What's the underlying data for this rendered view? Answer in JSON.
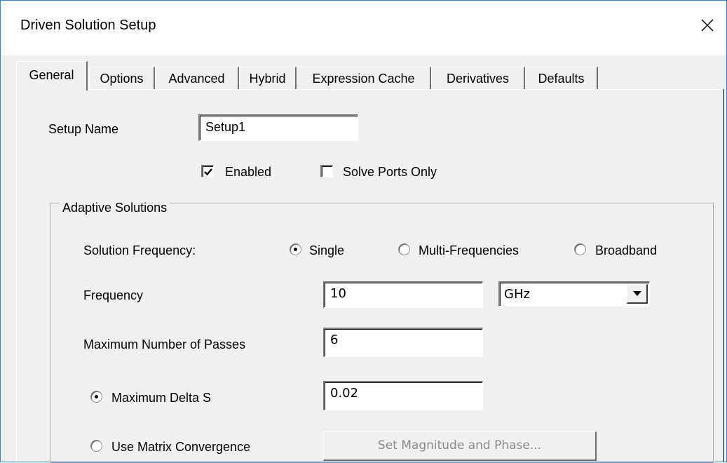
{
  "window": {
    "title": "Driven Solution Setup",
    "close_icon": "close-icon"
  },
  "tabs": [
    {
      "label": "General",
      "active": true
    },
    {
      "label": "Options",
      "active": false
    },
    {
      "label": "Advanced",
      "active": false
    },
    {
      "label": "Hybrid",
      "active": false
    },
    {
      "label": "Expression Cache",
      "active": false
    },
    {
      "label": "Derivatives",
      "active": false
    },
    {
      "label": "Defaults",
      "active": false
    }
  ],
  "general": {
    "setup_name_label": "Setup Name",
    "setup_name_value": "Setup1",
    "enabled_label": "Enabled",
    "enabled_checked": true,
    "solve_ports_only_label": "Solve Ports Only",
    "solve_ports_only_checked": false
  },
  "adaptive": {
    "group_title": "Adaptive Solutions",
    "solution_frequency_label": "Solution Frequency:",
    "options": [
      {
        "label": "Single",
        "selected": true
      },
      {
        "label": "Multi-Frequencies",
        "selected": false
      },
      {
        "label": "Broadband",
        "selected": false
      }
    ],
    "frequency_label": "Frequency",
    "frequency_value": "10",
    "frequency_unit": "GHz",
    "max_passes_label": "Maximum Number of Passes",
    "max_passes_value": "6",
    "max_delta_s_label": "Maximum Delta S",
    "max_delta_s_selected": true,
    "max_delta_s_value": "0.02",
    "matrix_convergence_label": "Use Matrix Convergence",
    "matrix_convergence_selected": false,
    "set_mag_phase_label": "Set Magnitude and Phase..."
  }
}
